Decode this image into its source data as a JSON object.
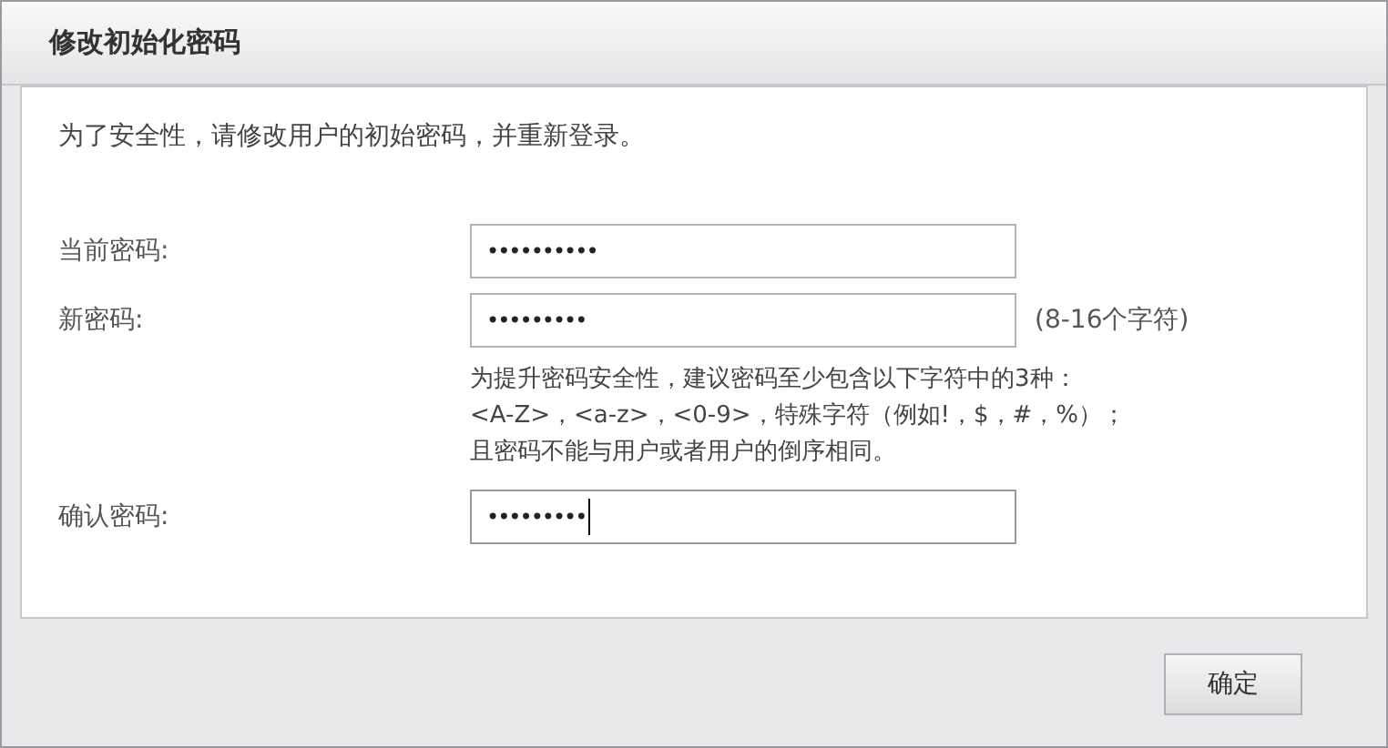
{
  "window": {
    "title": "修改初始化密码"
  },
  "intro": "为了安全性，请修改用户的初始密码，并重新登录。",
  "fields": [
    {
      "label": "当前密码:",
      "value": "••••••••••",
      "focused": false
    },
    {
      "label": "新密码:",
      "value": "•••••••••",
      "focused": false,
      "note": "(8-16个字符)",
      "help": [
        "为提升密码安全性，建议密码至少包含以下字符中的3种：",
        "<A-Z>，<a-z>，<0-9>，特殊字符（例如!，$，#，%）；",
        "且密码不能与用户或者用户的倒序相同。"
      ]
    },
    {
      "label": "确认密码:",
      "value": "•••••••••",
      "focused": true
    }
  ],
  "buttons": [
    "确定"
  ]
}
